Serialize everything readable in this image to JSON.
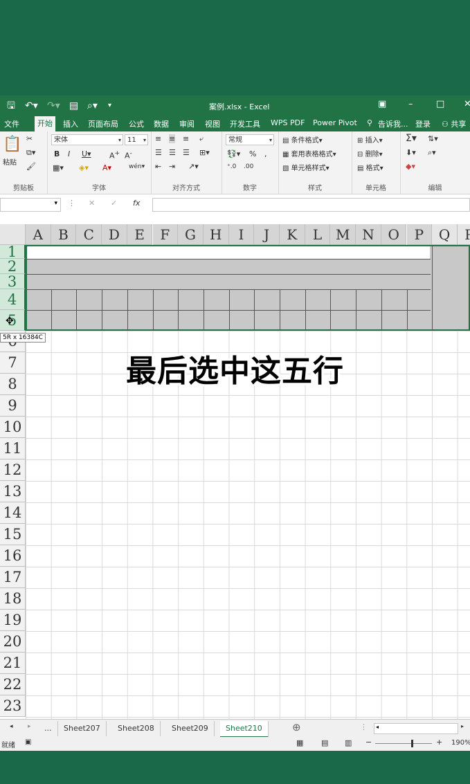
{
  "title": "案例.xlsx - Excel",
  "ribbon_tabs": [
    "文件",
    "开始",
    "插入",
    "页面布局",
    "公式",
    "数据",
    "审阅",
    "视图",
    "开发工具",
    "WPS PDF",
    "Power Pivot"
  ],
  "tell_me": "告诉我...",
  "login": "登录",
  "share": "共享",
  "font": {
    "name": "宋体",
    "size": "11"
  },
  "number_format": "常规",
  "styles": {
    "conditional": "条件格式",
    "table": "套用表格格式",
    "cell": "单元格样式"
  },
  "cells_group": {
    "insert": "插入",
    "delete": "删除",
    "format": "格式"
  },
  "paste_label": "粘贴",
  "groups": {
    "clipboard": "剪贴板",
    "font": "字体",
    "align": "对齐方式",
    "number": "数字",
    "styles": "样式",
    "cells": "单元格",
    "edit": "编辑"
  },
  "fx": "fx",
  "columns": [
    "A",
    "B",
    "C",
    "D",
    "E",
    "F",
    "G",
    "H",
    "I",
    "J",
    "K",
    "L",
    "M",
    "N",
    "O",
    "P",
    "Q",
    "R"
  ],
  "rows": [
    "1",
    "2",
    "3",
    "4",
    "5",
    "6",
    "7",
    "8",
    "9",
    "10",
    "11",
    "12",
    "13",
    "14",
    "15",
    "16",
    "17",
    "18",
    "19",
    "20",
    "21",
    "22",
    "23"
  ],
  "tooltip": "5R x 16384C",
  "caption": "最后选中这五行",
  "sheets": [
    "...",
    "Sheet207",
    "Sheet208",
    "Sheet209",
    "Sheet210"
  ],
  "active_sheet": "Sheet210",
  "status": "就绪",
  "zoom": "190%",
  "colors": {
    "accent": "#217346",
    "background": "#1a6a4a",
    "selection": "#c8c8c8"
  }
}
